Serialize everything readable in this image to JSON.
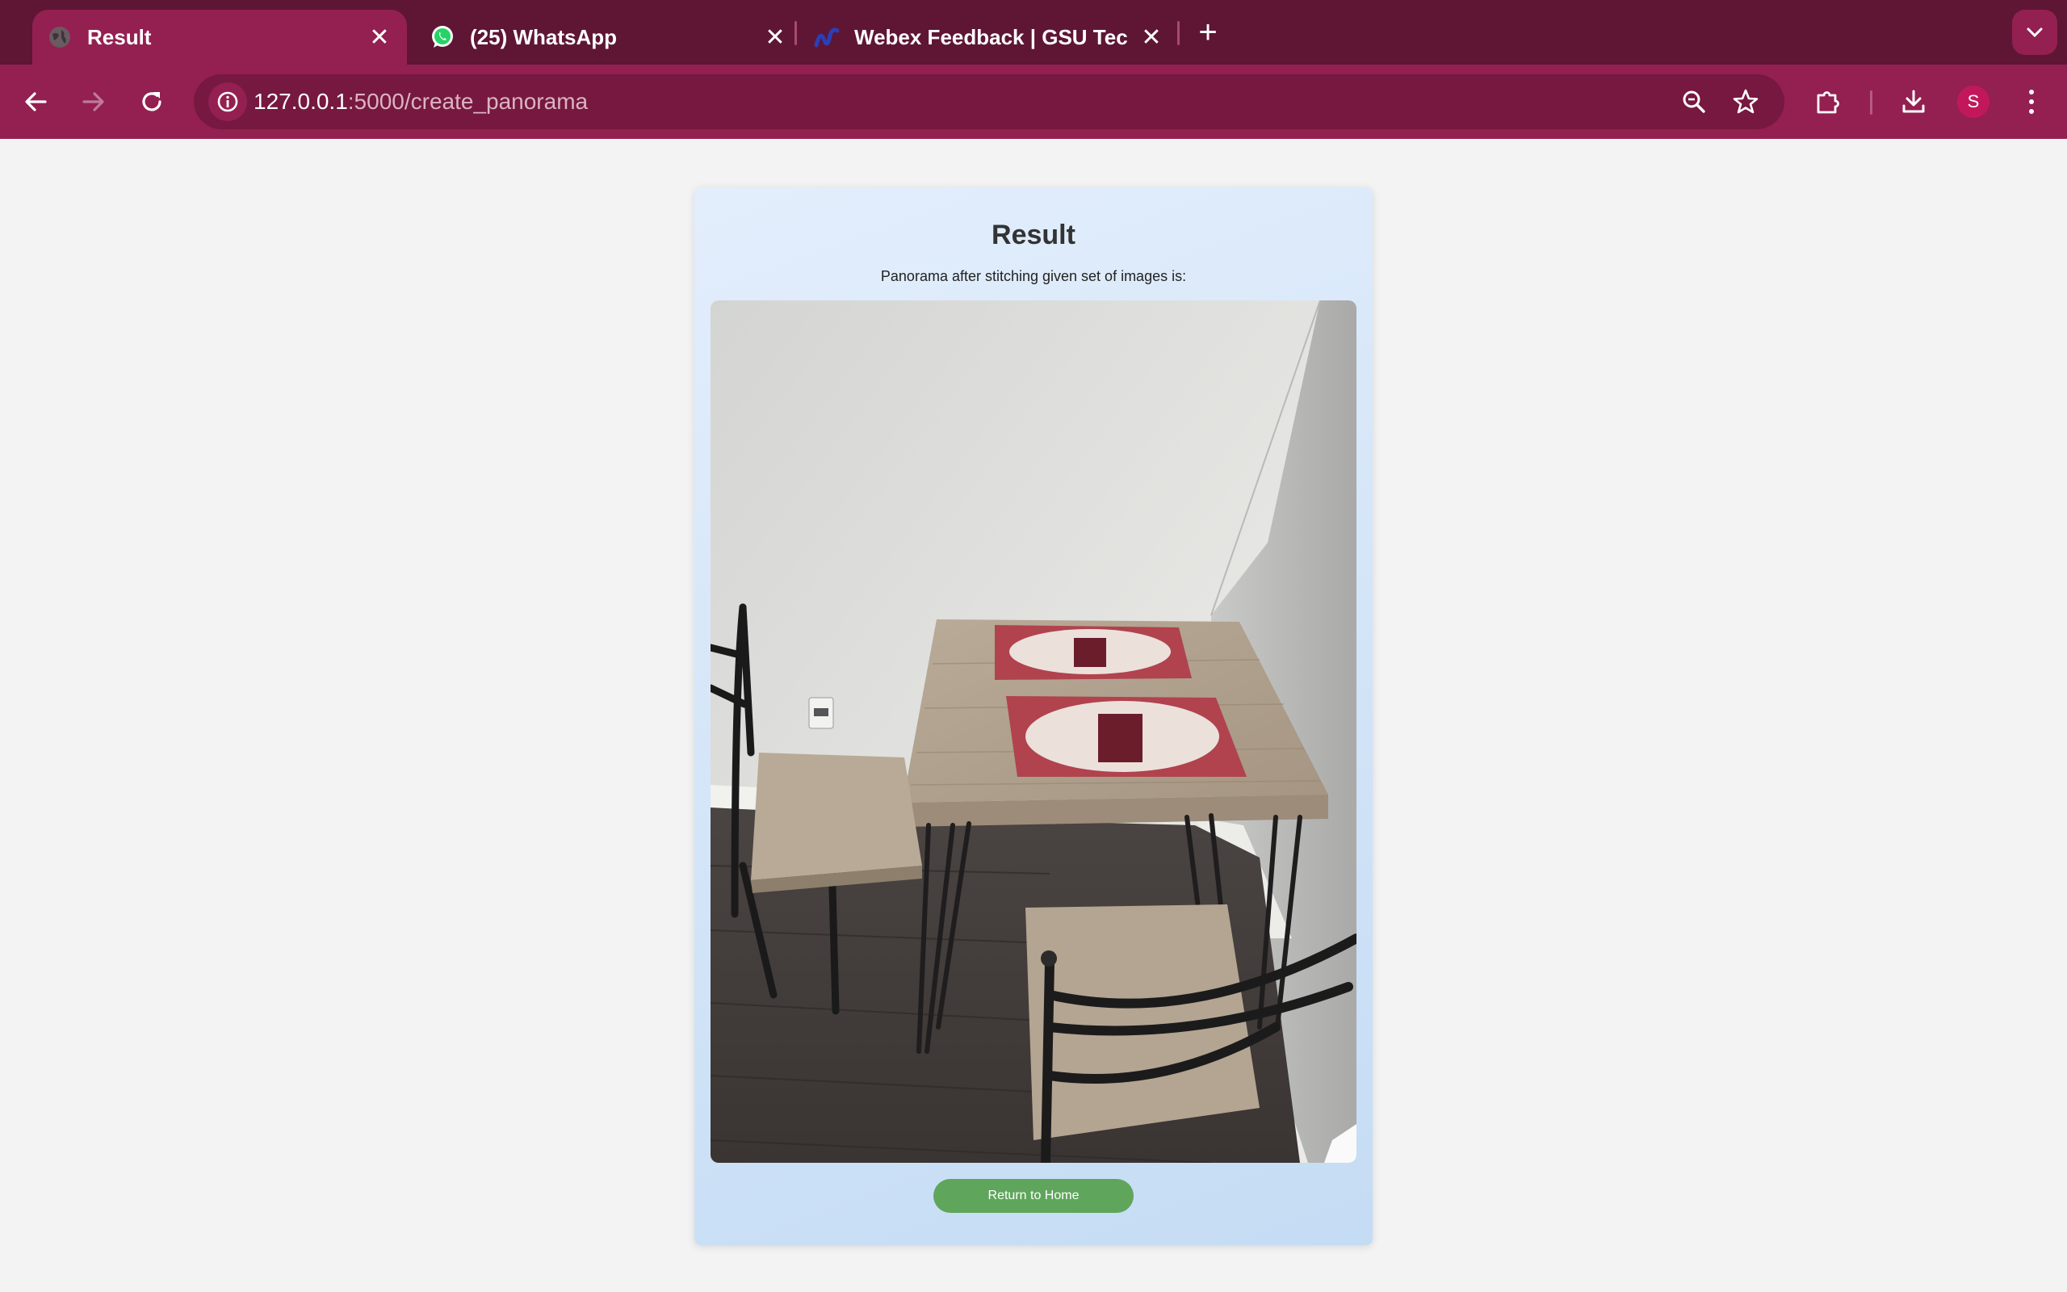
{
  "browser": {
    "tabs": [
      {
        "title": "Result",
        "active": true,
        "icon": "globe-icon"
      },
      {
        "title": "(25) WhatsApp",
        "active": false,
        "icon": "whatsapp-icon"
      },
      {
        "title": "Webex Feedback | GSU Tech",
        "active": false,
        "icon": "webex-icon"
      }
    ],
    "url_host": "127.0.0.1",
    "url_rest": ":5000/create_panorama",
    "profile_initial": "S",
    "colors": {
      "frame": "#5e1634",
      "toolbar": "#932050",
      "omnibox": "#76183f"
    }
  },
  "page": {
    "title": "Result",
    "subtitle": "Panorama after stitching given set of images is:",
    "image_description_icon": "panorama-photo",
    "return_button": "Return to Home",
    "colors": {
      "button": "#5fa65c",
      "card": "#d5e6f8"
    }
  }
}
